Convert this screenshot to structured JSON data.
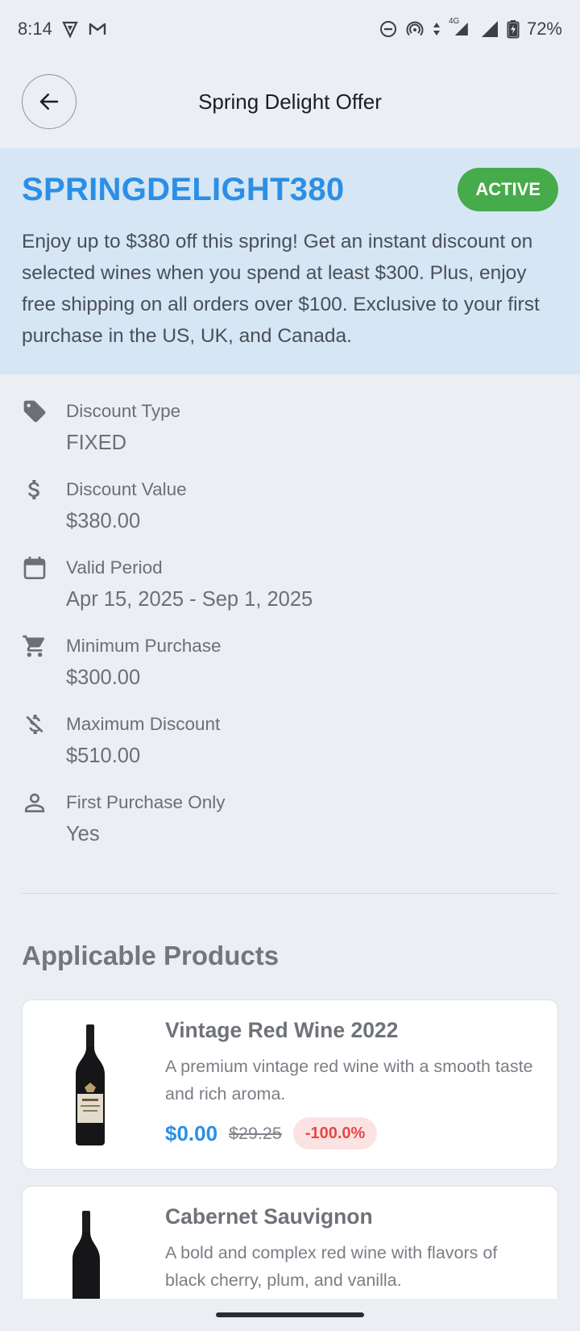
{
  "status_bar": {
    "time": "8:14",
    "network": "4G",
    "battery": "72%",
    "left_icons": [
      "vpn-shield-icon",
      "gmail-icon"
    ],
    "right_icons": [
      "do-not-disturb-icon",
      "hotspot-icon",
      "data-arrows-icon",
      "signal-icon",
      "wifi-signal-icon",
      "battery-charging-icon"
    ]
  },
  "header": {
    "title": "Spring Delight Offer",
    "back_icon": "arrow-left-icon"
  },
  "promo": {
    "code": "SPRINGDELIGHT380",
    "status": "ACTIVE",
    "status_color": "#46ab4a",
    "description": "Enjoy up to $380 off this spring! Get an instant discount on selected wines when you spend at least $300. Plus, enjoy free shipping on all orders over $100. Exclusive to your first purchase in the US, UK, and Canada."
  },
  "details": [
    {
      "icon": "tag-icon",
      "label": "Discount Type",
      "value": "FIXED"
    },
    {
      "icon": "dollar-icon",
      "label": "Discount Value",
      "value": "$380.00"
    },
    {
      "icon": "calendar-icon",
      "label": "Valid Period",
      "value": "Apr 15, 2025 - Sep 1, 2025"
    },
    {
      "icon": "cart-icon",
      "label": "Minimum Purchase",
      "value": "$300.00"
    },
    {
      "icon": "money-off-icon",
      "label": "Maximum Discount",
      "value": "$510.00"
    },
    {
      "icon": "person-icon",
      "label": "First Purchase Only",
      "value": "Yes"
    }
  ],
  "products_section": {
    "title": "Applicable Products",
    "items": [
      {
        "name": "Vintage Red Wine 2022",
        "description": "A premium vintage red wine with a smooth taste and rich aroma.",
        "price": "$0.00",
        "original_price": "$29.25",
        "discount": "-100.0%",
        "image": "wine-bottle-image"
      },
      {
        "name": "Cabernet Sauvignon",
        "description": "A bold and complex red wine with flavors of black cherry, plum, and vanilla.",
        "image": "wine-bottle-image"
      }
    ]
  },
  "colors": {
    "accent": "#2b8fe6",
    "hero_bg": "#d6e6f4",
    "discount_red": "#e64848",
    "page_bg": "#ebeef3"
  }
}
